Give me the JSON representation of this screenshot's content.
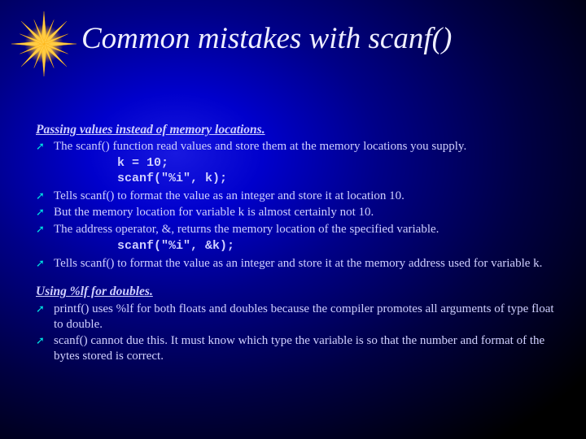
{
  "title": "Common mistakes with scanf()",
  "section1": {
    "heading": "Passing values instead of memory locations.",
    "bullets1": [
      "The scanf() function read values and store them at the memory locations you supply."
    ],
    "code1": "k = 10;\nscanf(\"%i\", k);",
    "bullets2": [
      "Tells scanf() to format the value as an integer and store it at location 10.",
      "But the memory location for variable k is almost certainly not 10.",
      "The address operator, &, returns the memory location of the specified variable."
    ],
    "code2": "scanf(\"%i\", &k);",
    "bullets3": [
      "Tells scanf() to format the value as an integer and store it at the memory address used for variable k."
    ]
  },
  "section2": {
    "heading": "Using %lf for doubles.",
    "bullets": [
      "printf() uses %lf for both floats and doubles because the compiler promotes all arguments of type float to double.",
      "scanf() cannot due this. It must know which type the variable is so that the number and format of the bytes stored is correct."
    ]
  }
}
